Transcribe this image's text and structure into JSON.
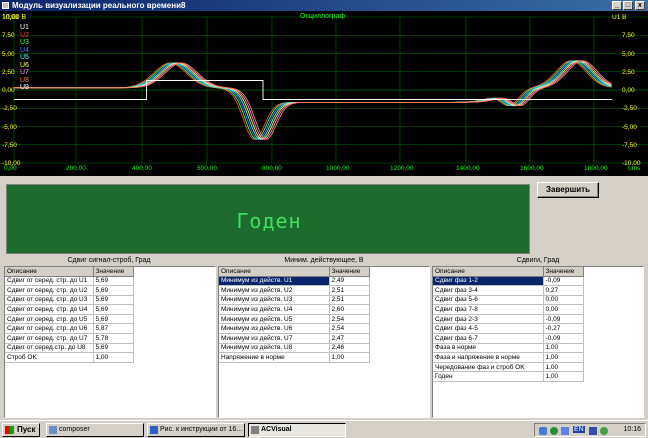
{
  "window": {
    "title": "Модуль визуализации реального времени8",
    "min": "_",
    "max": "□",
    "close": "x"
  },
  "scope": {
    "title": "Осциллограф",
    "y_left_ticks": [
      "10,00",
      "7,50",
      "5,00",
      "2,50",
      "0,00",
      "-2,50",
      "-5,00",
      "-7,50",
      "-10,00"
    ],
    "y_right_ticks": [
      "10,00",
      "7,50",
      "5,00",
      "2,50",
      "0,00",
      "-2,50",
      "-5,00",
      "-7,50",
      "-10,00"
    ],
    "right_channel_label": "U1 В",
    "x_ticks": [
      "0,00",
      "200,00",
      "400,00",
      "600,00",
      "800,00",
      "1000,00",
      "1200,00",
      "1400,00",
      "1600,00",
      "1800,00"
    ],
    "x_unit": "t,ms",
    "channels": [
      {
        "name": "U1",
        "color": "#ffffff"
      },
      {
        "name": "U2",
        "color": "#ff4040"
      },
      {
        "name": "U3",
        "color": "#40ff40"
      },
      {
        "name": "U4",
        "color": "#4080ff"
      },
      {
        "name": "U5",
        "color": "#40ffff"
      },
      {
        "name": "U6",
        "color": "#ffff40"
      },
      {
        "name": "U7",
        "color": "#ff80ff"
      },
      {
        "name": "U8",
        "color": "#ff8040"
      },
      {
        "name": "U9",
        "color": "#ffffff"
      }
    ],
    "top_left_label": "10,00 В"
  },
  "status": {
    "text": "Годен"
  },
  "finish_button": "Завершить",
  "grids": [
    {
      "title": "Сдвиг сигнал-строб, Град",
      "headers": [
        "Описание",
        "Значение"
      ],
      "rows": [
        [
          "Сдвиг от серед. стр. до U1",
          "5,69"
        ],
        [
          "Сдвиг от серед. стр. до U2",
          "5,69"
        ],
        [
          "Сдвиг от серед. стр. до U3",
          "5,69"
        ],
        [
          "Сдвиг от серед. стр. до U4",
          "5,69"
        ],
        [
          "Сдвиг от серед. стр. до U5",
          "5,69"
        ],
        [
          "Сдвиг от серед. стр. до U6",
          "5,87"
        ],
        [
          "Сдвиг от серед. стр. до U7",
          "5,78"
        ],
        [
          "Сдвиг от серед.стр. до U8",
          "5,69"
        ],
        [
          "Строб OK",
          "1,00"
        ]
      ]
    },
    {
      "title": "Миним. действующее, В",
      "headers": [
        "Описание",
        "Значение"
      ],
      "rows": [
        [
          "Минимум из действ. U1",
          "2,49"
        ],
        [
          "Минимум из действ. U2",
          "2,51"
        ],
        [
          "Минимум из действ. U3",
          "2,51"
        ],
        [
          "Минимум из действ. U4",
          "2,60"
        ],
        [
          "Минимум из действ. U5",
          "2,54"
        ],
        [
          "Минимум из действ. U6",
          "2,54"
        ],
        [
          "Минимум из действ. U7",
          "2,47"
        ],
        [
          "Минимум из действ. U8",
          "2,46"
        ],
        [
          "Напряжение в норме",
          "1,00"
        ]
      ]
    },
    {
      "title": "Сдвиги, Град",
      "headers": [
        "Описание",
        "Значение"
      ],
      "rows": [
        [
          "Сдвиг фаз 1-2",
          "-0,09"
        ],
        [
          "Сдвиг фаз 3-4",
          "0,27"
        ],
        [
          "Сдвиг фаз 5-6",
          "0,00"
        ],
        [
          "Сдвиг фаз 7-8",
          "0,00"
        ],
        [
          "Сдвиг фаз 2-3",
          "-0,09"
        ],
        [
          "Сдвиг фаз 4-5",
          "-0,27"
        ],
        [
          "Сдвиг фаз 6-7",
          "-0,09"
        ],
        [
          "Фаза в норме",
          "1,00"
        ],
        [
          "Фаза и напряжение в норме",
          "1,00"
        ],
        [
          "Чередование фаз и строб OK",
          "1,00"
        ],
        [
          "Годен",
          "1,00"
        ]
      ]
    }
  ],
  "taskbar": {
    "start": "Пуск",
    "tasks": [
      "composer",
      "Рис. к инструкции от 16...",
      "ACVisual"
    ],
    "lang": "EN",
    "clock": "10:16"
  }
}
